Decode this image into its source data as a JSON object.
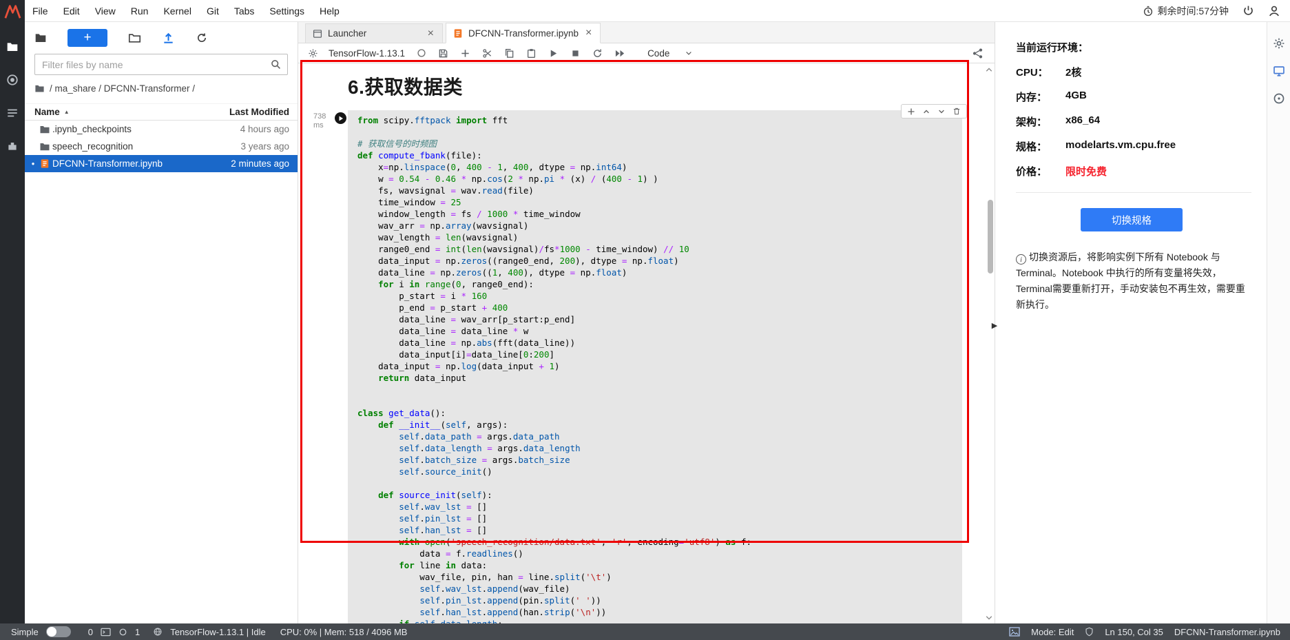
{
  "glyphs": {
    "close": "×",
    "sort_asc": "▲",
    "collapse_right": "▶"
  },
  "menubar": {
    "items": [
      "File",
      "Edit",
      "View",
      "Run",
      "Kernel",
      "Git",
      "Tabs",
      "Settings",
      "Help"
    ],
    "remaining_time": "剩余时间:57分钟"
  },
  "file_browser": {
    "new_button": "+",
    "filter_placeholder": "Filter files by name",
    "breadcrumb": "/ ma_share / DFCNN-Transformer /",
    "columns": {
      "name": "Name",
      "modified": "Last Modified"
    },
    "files": [
      {
        "name": ".ipynb_checkpoints",
        "modified": "4 hours ago",
        "type": "folder",
        "selected": false,
        "unsaved": false
      },
      {
        "name": "speech_recognition",
        "modified": "3 years ago",
        "type": "folder",
        "selected": false,
        "unsaved": false
      },
      {
        "name": "DFCNN-Transformer.ipynb",
        "modified": "2 minutes ago",
        "type": "notebook",
        "selected": true,
        "unsaved": true
      }
    ]
  },
  "tabs": [
    {
      "label": "Launcher",
      "active": false
    },
    {
      "label": "DFCNN-Transformer.ipynb",
      "active": true
    }
  ],
  "notebook_toolbar": {
    "kernel_name": "TensorFlow-1.13.1",
    "cell_type": "Code"
  },
  "notebook": {
    "heading": "6.获取数据类",
    "cell": {
      "exec_time_value": "738",
      "exec_time_unit": "ms",
      "code_lines": [
        "from scipy.fftpack import fft",
        "",
        "# 获取信号的时频图",
        "def compute_fbank(file):",
        "    x=np.linspace(0, 400 - 1, 400, dtype = np.int64)",
        "    w = 0.54 - 0.46 * np.cos(2 * np.pi * (x) / (400 - 1) )",
        "    fs, wavsignal = wav.read(file)",
        "    time_window = 25",
        "    window_length = fs / 1000 * time_window",
        "    wav_arr = np.array(wavsignal)",
        "    wav_length = len(wavsignal)",
        "    range0_end = int(len(wavsignal)/fs*1000 - time_window) // 10",
        "    data_input = np.zeros((range0_end, 200), dtype = np.float)",
        "    data_line = np.zeros((1, 400), dtype = np.float)",
        "    for i in range(0, range0_end):",
        "        p_start = i * 160",
        "        p_end = p_start + 400",
        "        data_line = wav_arr[p_start:p_end]",
        "        data_line = data_line * w",
        "        data_line = np.abs(fft(data_line))",
        "        data_input[i]=data_line[0:200]",
        "    data_input = np.log(data_input + 1)",
        "    return data_input",
        "",
        "",
        "class get_data():",
        "    def __init__(self, args):",
        "        self.data_path = args.data_path",
        "        self.data_length = args.data_length",
        "        self.batch_size = args.batch_size",
        "        self.source_init()",
        "",
        "    def source_init(self):",
        "        self.wav_lst = []",
        "        self.pin_lst = []",
        "        self.han_lst = []",
        "        with open('speech_recognition/data.txt', 'r', encoding='utf8') as f:",
        "            data = f.readlines()",
        "        for line in data:",
        "            wav_file, pin, han = line.split('\\t')",
        "            self.wav_lst.append(wav_file)",
        "            self.pin_lst.append(pin.split(' '))",
        "            self.han_lst.append(han.strip('\\n'))",
        "        if self.data_length:"
      ]
    }
  },
  "right_panel": {
    "title": "当前运行环境：",
    "specs": [
      {
        "label": "CPU：",
        "value": "2核",
        "highlight": false
      },
      {
        "label": "内存：",
        "value": "4GB",
        "highlight": false
      },
      {
        "label": "架构：",
        "value": "x86_64",
        "highlight": false
      },
      {
        "label": "规格：",
        "value": "modelarts.vm.cpu.free",
        "highlight": false
      },
      {
        "label": "价格：",
        "value": "限时免费",
        "highlight": true
      }
    ],
    "switch_button": "切换规格",
    "notice": "切换资源后，将影响实例下所有 Notebook 与 Terminal。Notebook 中执行的所有变量将失效，Terminal需要重新打开，手动安装包不再生效，需要重新执行。"
  },
  "status_bar": {
    "simple_label": "Simple",
    "terminals_count": "0",
    "kernels_count": "1",
    "kernel_status": "TensorFlow-1.13.1 | Idle",
    "resources": "CPU: 0% | Mem: 518 / 4096 MB",
    "mode": "Mode: Edit",
    "cursor_position": "Ln 150, Col 35",
    "filename": "DFCNN-Transformer.ipynb"
  },
  "colors": {
    "accent_blue": "#1a73e8",
    "selection_blue": "#1a68c9",
    "button_blue": "#2f7bf6",
    "price_red": "#f5222d",
    "annotation_red": "#ee0000"
  }
}
